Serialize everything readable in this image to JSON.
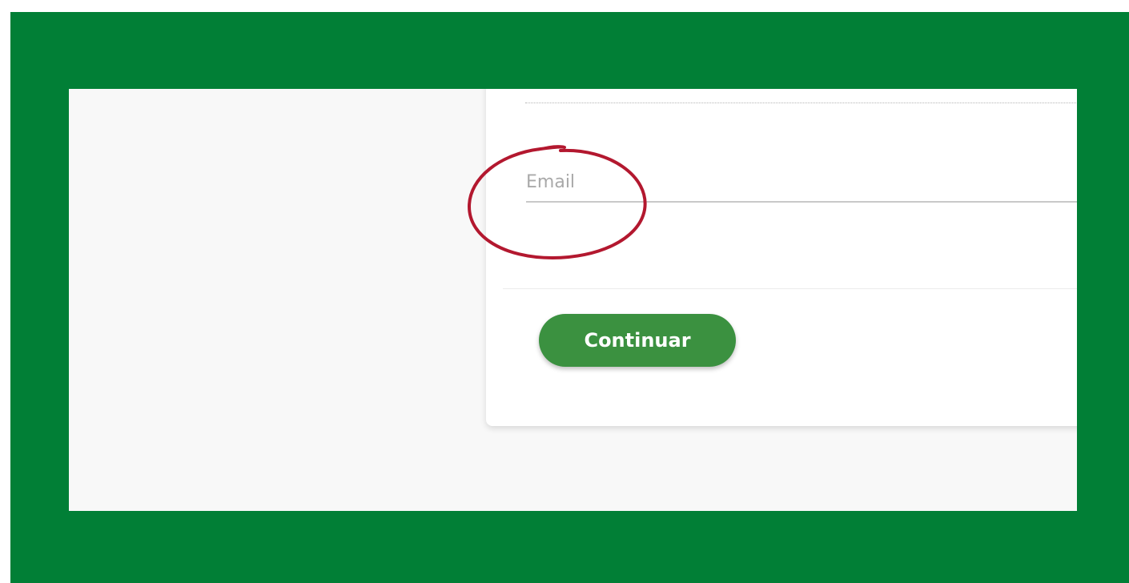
{
  "form": {
    "email_placeholder": "Email",
    "email_value": "",
    "continue_label": "Continuar"
  },
  "colors": {
    "frame": "#017f36",
    "page_background": "#f8f8f8",
    "button": "#3b9140",
    "annotation": "#b3182f"
  }
}
